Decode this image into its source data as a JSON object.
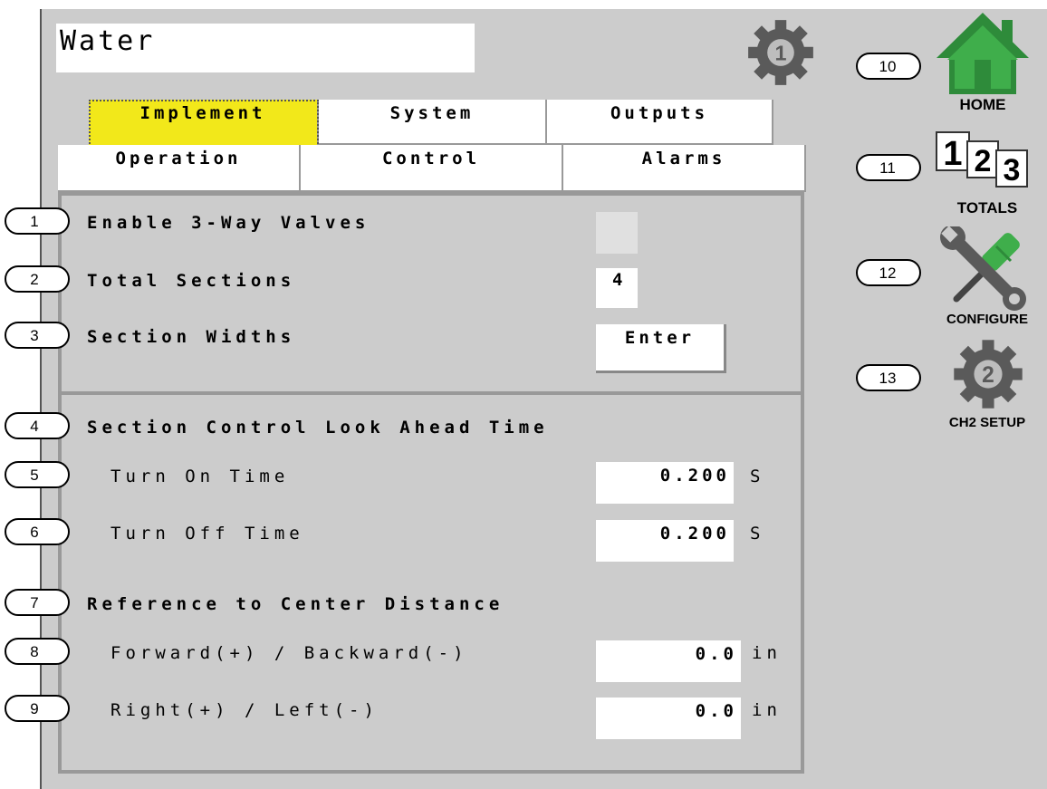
{
  "header": {
    "title": "Water"
  },
  "tabs_row1": [
    {
      "label": "Implement",
      "active": true
    },
    {
      "label": "System",
      "active": false
    },
    {
      "label": "Outputs",
      "active": false
    }
  ],
  "tabs_row2": [
    {
      "label": "Operation"
    },
    {
      "label": "Control"
    },
    {
      "label": "Alarms"
    }
  ],
  "section1": {
    "enable_3way": {
      "label": "Enable 3-Way Valves",
      "checked": false
    },
    "total_sections": {
      "label": "Total Sections",
      "value": "4"
    },
    "section_widths": {
      "label": "Section Widths",
      "button": "Enter"
    }
  },
  "section2": {
    "look_ahead_heading": "Section Control Look Ahead Time",
    "turn_on": {
      "label": "Turn On Time",
      "value": "0.200",
      "unit": "S"
    },
    "turn_off": {
      "label": "Turn Off Time",
      "value": "0.200",
      "unit": "S"
    },
    "ref_heading": "Reference to Center Distance",
    "forward": {
      "label": "Forward(+) / Backward(-)",
      "value": "0.0",
      "unit": "in"
    },
    "right": {
      "label": "Right(+) / Left(-)",
      "value": "0.0",
      "unit": "in"
    }
  },
  "callouts": [
    "1",
    "2",
    "3",
    "4",
    "5",
    "6",
    "7",
    "8",
    "9",
    "10",
    "11",
    "12",
    "13"
  ],
  "nav": {
    "home": "HOME",
    "totals": "TOTALS",
    "totals_digits": [
      "1",
      "2",
      "3"
    ],
    "configure": "CONFIGURE",
    "ch2_setup": "CH2 SETUP",
    "ch2_number": "2",
    "ch1_number": "1"
  },
  "colors": {
    "background": "#cccccc",
    "active_tab": "#f2e81a",
    "home_green": "#2e8b3a",
    "icon_gray": "#5a5a5a"
  }
}
